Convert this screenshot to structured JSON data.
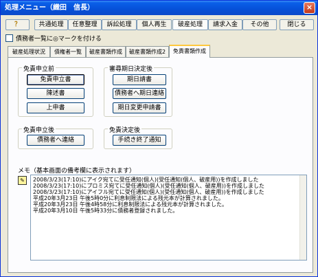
{
  "window": {
    "title": "処理メニュー（織田　信長）",
    "close_label": "×"
  },
  "toolbar": {
    "help_label": "？",
    "buttons": [
      "共通処理",
      "任意整理",
      "訴訟処理",
      "個人再生",
      "破産処理",
      "請求入金",
      "その他"
    ],
    "close_label": "閉じる"
  },
  "mark_checkbox_label": "債務者一覧に◎マークを付ける",
  "tabs": [
    "破産処理状況",
    "債権者一覧",
    "破産書類作成",
    "破産書類作成2",
    "免責書類作成"
  ],
  "groups": {
    "menseki_moushitate_mae": {
      "label": "免責申立前",
      "buttons": [
        "免責申立書",
        "陳述書",
        "上申書"
      ]
    },
    "shinjin_kijitsu": {
      "label": "審尋期日決定後",
      "buttons": [
        "期日請書",
        "債務者へ期日連絡",
        "期日変更申請書"
      ]
    },
    "menseki_moushitate_go": {
      "label": "免責申立後",
      "buttons": [
        "債務者へ連絡"
      ]
    },
    "menseki_kettei_go": {
      "label": "免責決定後",
      "buttons": [
        "手続き終了通知"
      ]
    }
  },
  "memo": {
    "label": "メモ（基本画面の備考欄に表示されます）",
    "icon": "memo-icon",
    "lines": [
      "2008/3/23(17:10)にアイク宛てに受任通知(個人)(受任通知(個人、破産用))を作成しました",
      "2008/3/23(17:10)にプロミス宛てに受任通知(個人)(受任通知(個人、破産用))を作成しました",
      "2008/3/23(17:10)にアイフル宛てに受任通知(個人)(受任通知(個人、破産用))を作成しました",
      "平成20年3月23日 午後5時0分に利息制限法による残元本が計算されました。",
      "平成20年3月23日 午後4時58分に利息制限法による残元本が計算されました。",
      "平成20年3月10日 午後5時33分に債務者登録されました。"
    ]
  }
}
